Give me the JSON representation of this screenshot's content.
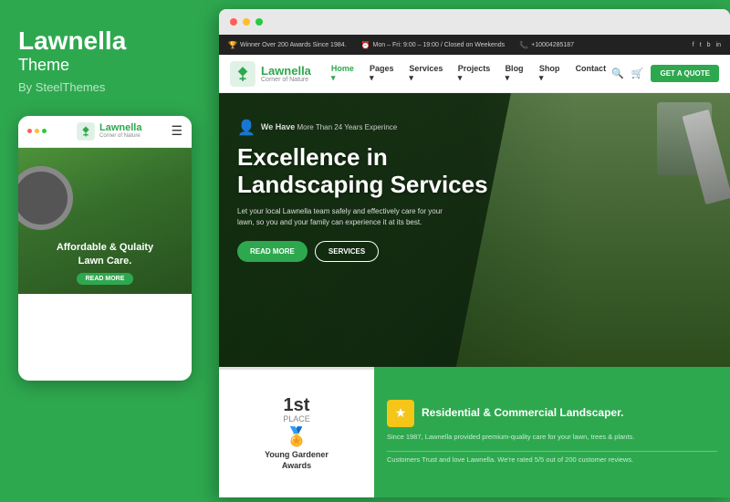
{
  "left": {
    "brand": "Lawnella",
    "theme_label": "Theme",
    "author": "By SteelThemes",
    "mobile": {
      "logo_text": "Lawnella",
      "logo_sub": "Corner of Nature",
      "hero_text": "Affordable & Qulaity\nLawn Care.",
      "hero_btn": "READ MORE"
    }
  },
  "topbar": {
    "award": "Winner Over 200 Awards Since 1984.",
    "hours": "Mon – Fri: 9:00 – 19:00 / Closed on Weekends",
    "phone": "+10004285187",
    "socials": [
      "f",
      "t",
      "b",
      "in"
    ]
  },
  "nav": {
    "logo_text": "Lawnella",
    "logo_sub": "Corner of Nature",
    "links": [
      "Home",
      "Pages",
      "Services",
      "Projects",
      "Blog",
      "Shop",
      "Contact"
    ],
    "cta": "GET A QUOTE"
  },
  "hero": {
    "badge_line1": "We Have",
    "badge_line2": "More Than 24 Years Experince",
    "heading": "Excellence in\nLandscaping Services",
    "desc": "Let your local Lawnella team safely and effectively care for your lawn, so you and your family can experience it at its best.",
    "btn_primary": "READ MORE",
    "btn_secondary": "SERVICES"
  },
  "award_card": {
    "place_num": "1st",
    "place_label": "PLACE",
    "name_line1": "Young Gardener",
    "name_line2": "Awards"
  },
  "promo_card": {
    "star": "★",
    "title": "Residential & Commercial Landscaper.",
    "desc1": "Since 1987, Lawnella provided premium-quality care for your lawn, trees & plants.",
    "divider": "",
    "desc2": "Customers Trust and love Lawnella. We're rated 5/5 out of 200 customer reviews."
  },
  "colors": {
    "green": "#2ea84f",
    "dark": "#222222"
  }
}
